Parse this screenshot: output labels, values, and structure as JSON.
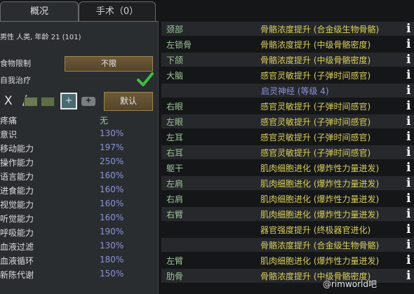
{
  "tabs": [
    {
      "label": "概况"
    },
    {
      "label": "手术（0）"
    }
  ],
  "overview": {
    "summary": "男性 人类, 年龄 21 (101)",
    "food_label": "食物限制",
    "food_value": "不限",
    "self_tend_label": "自我治疗",
    "default_button": "默认"
  },
  "capacities": [
    {
      "name": "疼痛",
      "value": "无"
    },
    {
      "name": "意识",
      "value": "130%"
    },
    {
      "name": "移动能力",
      "value": "197%"
    },
    {
      "name": "操作能力",
      "value": "250%"
    },
    {
      "name": "语言能力",
      "value": "160%"
    },
    {
      "name": "进食能力",
      "value": "160%"
    },
    {
      "name": "视觉能力",
      "value": "160%"
    },
    {
      "name": "听觉能力",
      "value": "160%"
    },
    {
      "name": "呼吸能力",
      "value": "190%"
    },
    {
      "name": "血液过滤",
      "value": "130%"
    },
    {
      "name": "血液循环",
      "value": "180%"
    },
    {
      "name": "新陈代谢",
      "value": "150%"
    }
  ],
  "hediffs": [
    {
      "part": "颈部",
      "hediff": "骨骼浓度提升 (合金级生物骨骼)"
    },
    {
      "part": "左锁骨",
      "hediff": "骨骼浓度提升 (中级骨骼密度)"
    },
    {
      "part": "下颌",
      "hediff": "骨骼浓度提升 (中级骨骼密度)"
    },
    {
      "part": "大脑",
      "hediff": "感官灵敏提升 (子弹时间感官)"
    },
    {
      "part": "",
      "hediff": "启灵神经 (等级 4)"
    },
    {
      "part": "右眼",
      "hediff": "感官灵敏提升 (子弹时间感官)"
    },
    {
      "part": "左眼",
      "hediff": "感官灵敏提升 (子弹时间感官)"
    },
    {
      "part": "左耳",
      "hediff": "感官灵敏提升 (子弹时间感官)"
    },
    {
      "part": "右耳",
      "hediff": "感官灵敏提升 (子弹时间感官)"
    },
    {
      "part": "躯干",
      "hediff": "肌肉细胞进化 (爆炸性力量迸发)"
    },
    {
      "part": "左肩",
      "hediff": "肌肉细胞进化 (爆炸性力量迸发)"
    },
    {
      "part": "右肩",
      "hediff": "肌肉细胞进化 (爆炸性力量迸发)"
    },
    {
      "part": "右臂",
      "hediff": "肌肉细胞进化 (爆炸性力量迸发)"
    },
    {
      "part": "",
      "hediff": "器官强度提升 (终极器官进化)"
    },
    {
      "part": "",
      "hediff": "骨骼浓度提升 (合金级生物骨骼)"
    },
    {
      "part": "左臂",
      "hediff": "肌肉细胞进化 (爆炸性力量迸发)"
    },
    {
      "part": "肋骨",
      "hediff": "骨骼浓度提升 (中级骨骼密度)"
    }
  ],
  "info_icon": "i",
  "watermark": "@rimworld吧",
  "colors": {
    "part": "#9ec49a",
    "hediff": "#d8cf5a",
    "psylink": "#8d92d8",
    "capacity": "#8d92d8",
    "button": "#6e5a38"
  }
}
